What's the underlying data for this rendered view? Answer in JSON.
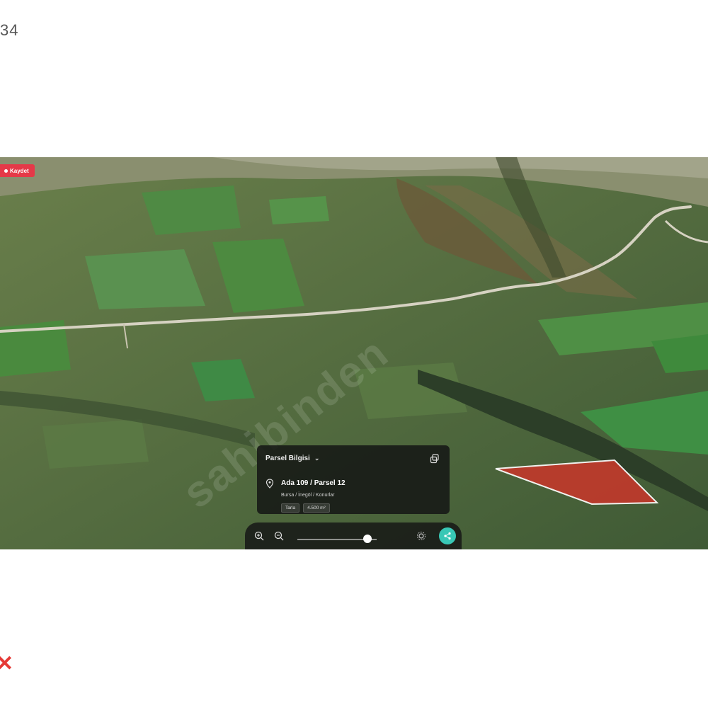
{
  "page": {
    "counter": "34",
    "logo_glyph": "✕"
  },
  "map": {
    "record_badge": "Kaydet",
    "watermark": "sahibinden",
    "parcel_fill": "#c0392b",
    "parcel_stroke": "#ffffff",
    "parcel_card": {
      "header": "Parsel Bilgisi",
      "title": "Ada 109 / Parsel 12",
      "location": "Bursa / İnegöl / Konurlar",
      "tags": [
        "Tarla",
        "4.500 m²"
      ]
    },
    "toolbar": {
      "icons": [
        "zoom-in-icon",
        "zoom-out-icon",
        "settings-icon",
        "share-icon"
      ],
      "slider_level": 0.88,
      "accent": "#38c7b5"
    }
  }
}
